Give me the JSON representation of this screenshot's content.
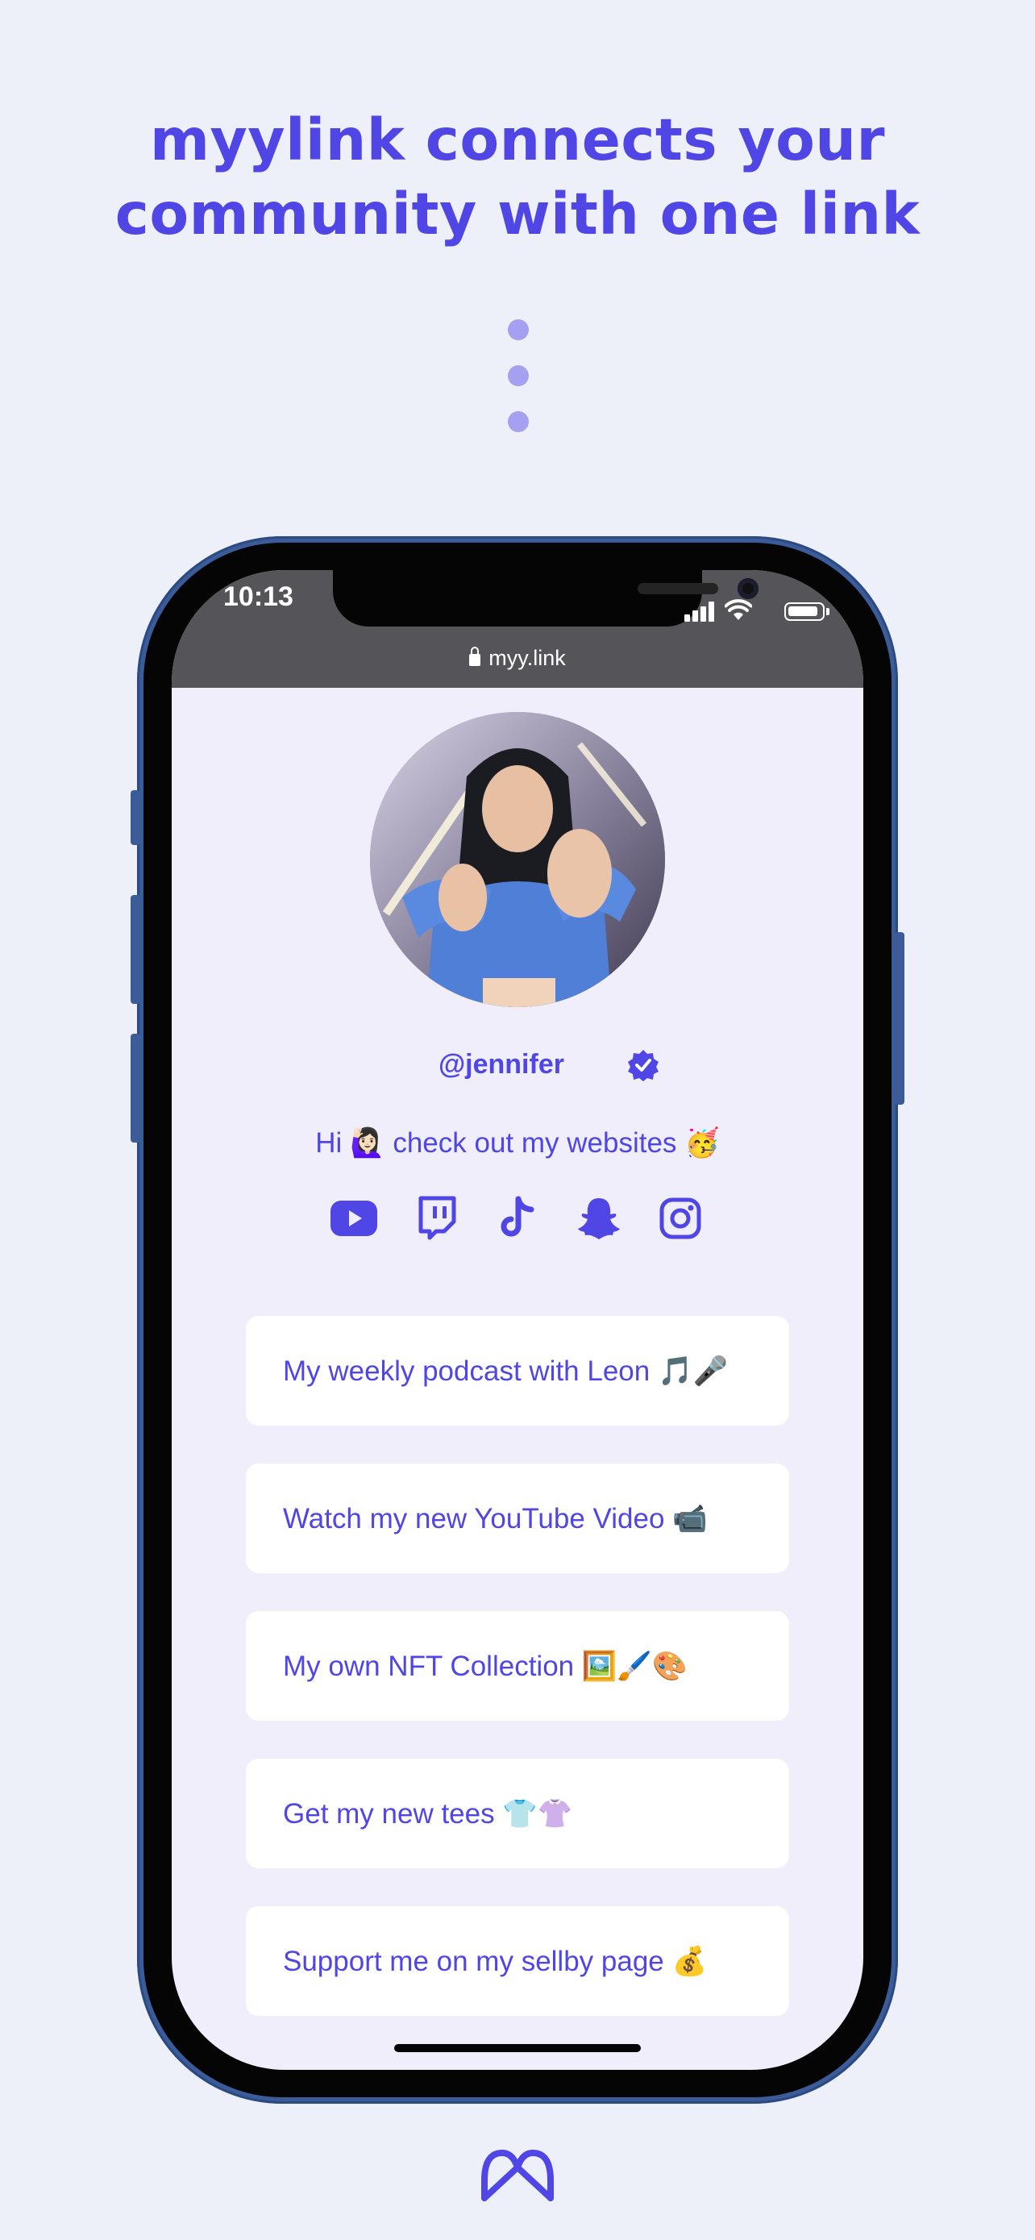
{
  "headline": {
    "line1": "myylink connects your",
    "line2": "community with one link"
  },
  "status_bar": {
    "time": "10:13"
  },
  "browser": {
    "url": "myy.link"
  },
  "profile": {
    "username": "@jennifer",
    "bio": "Hi 🙋🏻‍♀️ check out my websites 🥳",
    "avatar_icon": "profile-photo"
  },
  "socials": [
    {
      "name": "youtube-icon"
    },
    {
      "name": "twitch-icon"
    },
    {
      "name": "tiktok-icon"
    },
    {
      "name": "snapchat-icon"
    },
    {
      "name": "instagram-icon"
    }
  ],
  "links": [
    {
      "label": "My weekly podcast with Leon 🎵🎤"
    },
    {
      "label": "Watch my new YouTube Video 📹"
    },
    {
      "label": "My own NFT Collection 🖼️🖌️🎨"
    },
    {
      "label": "Get my new tees 👕👚"
    },
    {
      "label": "Support me on my sellby page 💰"
    }
  ],
  "colors": {
    "accent": "#4f46e5",
    "background": "#eef0f9",
    "dots": "#a5a0f0",
    "phone_frame": "#3b5c99"
  }
}
